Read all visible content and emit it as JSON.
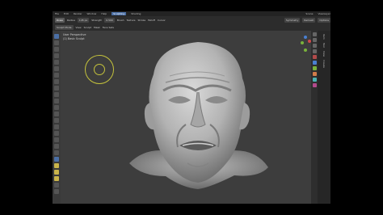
{
  "topbar": {
    "menus": [
      "File",
      "Edit",
      "Render",
      "Window",
      "Help"
    ],
    "workspace_active": "Sculpting",
    "workspace_next": "Shading",
    "scene": "Scene",
    "view_layer": "ViewLayer"
  },
  "header": {
    "row1": [
      "Draw",
      "Radius",
      "145 px",
      "Strength",
      "0.500",
      "Brush",
      "Texture",
      "Stroke",
      "Falloff",
      "Cursor"
    ],
    "row1_right": [
      "Symmetry",
      "Remesh",
      "Options"
    ],
    "row2": [
      "Sculpt Mode",
      "View",
      "Sculpt",
      "Mask",
      "Face Sets"
    ]
  },
  "viewport": {
    "view_name": "User Perspective",
    "object_name": "(1) Basic Sculpt"
  },
  "sidebar_tabs": [
    "Item",
    "Tool",
    "View",
    "Create"
  ],
  "colors": {
    "accent": "#4b6fa5",
    "brush_circle": "#c4c23c",
    "axis_x": "#d1484a",
    "axis_y": "#7ab23b",
    "axis_z": "#4a7fd1"
  }
}
